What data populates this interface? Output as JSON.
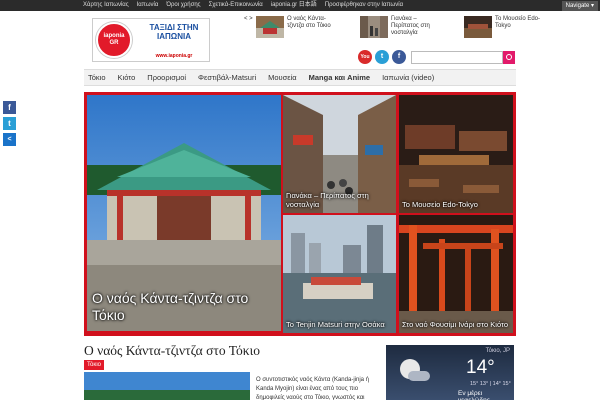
{
  "topbar": {
    "links": [
      "Χάρτης Ιαπωνίας",
      "Ιαπωνία",
      "Όροι χρήσης",
      "Σχετικά-Επικοινωνία",
      "iaponia.gr 日本語",
      "Προσφέρθηκαν στην Ιαπωνία"
    ],
    "navigate": "Navigate"
  },
  "logo": {
    "brand_line1": "iaponia",
    "brand_line2": "GR",
    "slogan": "ΤΑΞΙΔΙ ΣΤΗΝ ΙΑΠΩΝΙΑ",
    "url": "www.iaponia.gr"
  },
  "recent": {
    "arrows": "< >",
    "items": [
      {
        "title": "Ο ναός Κάντα-τζιντζα στο Τόκιο"
      },
      {
        "title": "Γιανάκα – Περίπατος στη νοσταλγία"
      },
      {
        "title": "Το Μουσείο Edo-Tokyo"
      }
    ]
  },
  "social": {
    "youtube": "You",
    "twitter": "t",
    "facebook": "f"
  },
  "search": {
    "placeholder": ""
  },
  "nav": {
    "items": [
      "Τόκιο",
      "Κιότο",
      "Προορισμοί",
      "Φεστιβάλ-Matsuri",
      "Μουσεία",
      "Manga και Anime",
      "Ιαπωνία (video)"
    ]
  },
  "share": {
    "facebook": "f",
    "twitter": "t",
    "share": "<"
  },
  "featured": [
    {
      "caption": "Ο ναός Κάντα-τζιντζα στο Τόκιο"
    },
    {
      "caption": "Γιανάκα – Περίπατος στη νοσταλγία"
    },
    {
      "caption": "Το Μουσείο Edo-Tokyo"
    },
    {
      "caption": "Το Tenjin Matsuri στην Οσάκα"
    },
    {
      "caption": "Στο ναό Φουσίμι Ινάρι στο Κιότο"
    }
  ],
  "post": {
    "title": "Ο ναός Κάντα-τζιντζα στο Τόκιο",
    "tag": "Τόκιο",
    "excerpt": "Ο συντοτιστικός ναός Κάντα (Kanda-jinja ή Kanda Myojin) είναι ένας από τους πιο δημοφιλείς ναούς στο Τόκιο, γνωστός και"
  },
  "weather": {
    "location": "Τόκιο, JP",
    "temperature": "14°",
    "hilo": "15° 13° | 14° 15°",
    "condition": "Εν μέρει νεφελώδης"
  }
}
